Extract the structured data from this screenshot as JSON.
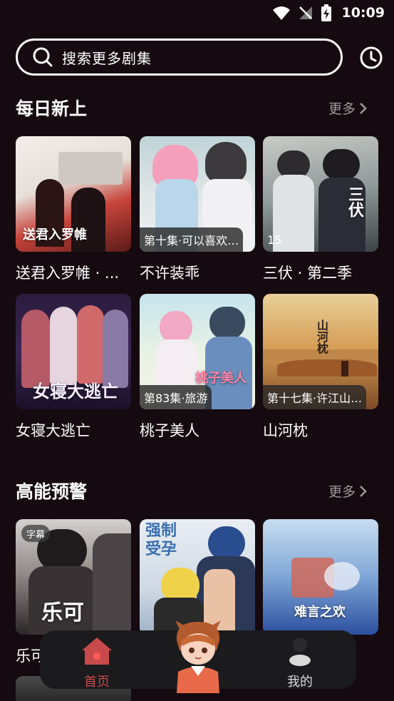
{
  "status_bar": {
    "time": "10:09"
  },
  "search": {
    "placeholder": "搜索更多剧集"
  },
  "sections": [
    {
      "title": "每日新上",
      "more_label": "更多",
      "items": [
        {
          "title": "送君入罗帷 · ...",
          "tag": "",
          "cover_text": "送君入罗帷"
        },
        {
          "title": "不许装乖",
          "tag": "第十集·可以喜欢…",
          "cover_text": ""
        },
        {
          "title": "三伏 · 第二季",
          "tag": "15",
          "cover_text": "三伏"
        },
        {
          "title": "女寝大逃亡",
          "tag": "",
          "cover_text": "女寝大逃亡"
        },
        {
          "title": "桃子美人",
          "tag": "第83集·旅游",
          "cover_text": "桃子美人"
        },
        {
          "title": "山河枕",
          "tag": "第十七集·许江山…",
          "cover_text": "山河枕"
        }
      ]
    },
    {
      "title": "高能预警",
      "more_label": "更多",
      "items": [
        {
          "title": "乐可",
          "tag": "",
          "badge": "字幕",
          "cover_text": "乐可"
        },
        {
          "title": "",
          "tag": "",
          "cover_text": "强制受孕"
        },
        {
          "title": "",
          "tag": "",
          "cover_text": "难言之欢"
        }
      ]
    }
  ],
  "nav": {
    "home_label": "首页",
    "mine_label": "我的",
    "active": "home"
  },
  "colors": {
    "background": "#150a0f",
    "muted_text": "#9b9a9e",
    "nav_active": "#c94a4a",
    "nav_inactive": "#d9d9d9"
  }
}
